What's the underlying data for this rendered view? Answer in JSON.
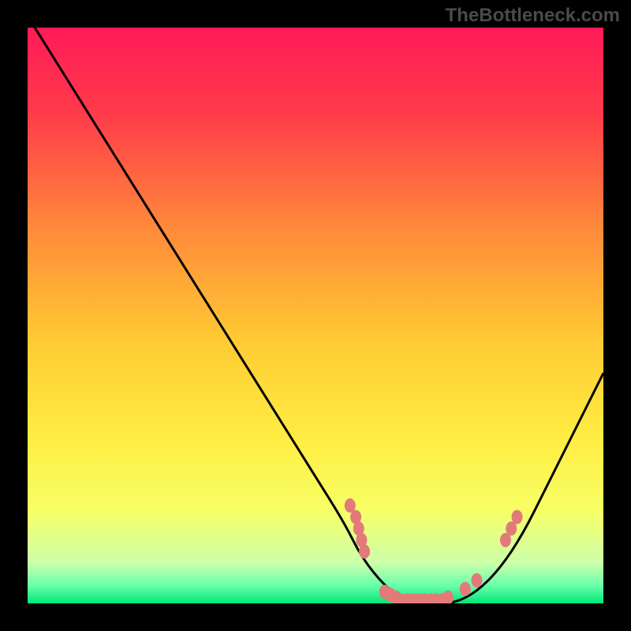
{
  "watermark": "TheBottleneck.com",
  "chart_data": {
    "type": "line",
    "title": "",
    "xlabel": "",
    "ylabel": "",
    "xlim": [
      0,
      100
    ],
    "ylim": [
      0,
      100
    ],
    "curve": {
      "description": "V-shaped bottleneck curve",
      "x": [
        0,
        5,
        10,
        15,
        20,
        25,
        30,
        35,
        40,
        45,
        50,
        55,
        58,
        62,
        66,
        70,
        74,
        78,
        82,
        86,
        90,
        95,
        100
      ],
      "y": [
        102,
        94,
        86,
        78,
        70,
        62,
        54,
        46,
        38,
        30,
        22,
        14,
        8,
        3,
        0,
        0,
        0,
        2,
        6,
        12,
        20,
        30,
        40
      ]
    },
    "highlight_points": {
      "description": "Salmon marker dots on curve near minimum plateau",
      "color": "#e27a7a",
      "points": [
        {
          "x": 56,
          "y": 17
        },
        {
          "x": 57,
          "y": 15
        },
        {
          "x": 57.5,
          "y": 13
        },
        {
          "x": 58,
          "y": 11
        },
        {
          "x": 58.5,
          "y": 9
        },
        {
          "x": 62,
          "y": 2
        },
        {
          "x": 63,
          "y": 1.5
        },
        {
          "x": 64,
          "y": 1
        },
        {
          "x": 65,
          "y": 0.5
        },
        {
          "x": 66,
          "y": 0.5
        },
        {
          "x": 67,
          "y": 0.5
        },
        {
          "x": 68,
          "y": 0.5
        },
        {
          "x": 69,
          "y": 0.5
        },
        {
          "x": 70,
          "y": 0.5
        },
        {
          "x": 71,
          "y": 0.5
        },
        {
          "x": 72,
          "y": 0.5
        },
        {
          "x": 73,
          "y": 1
        },
        {
          "x": 76,
          "y": 2.5
        },
        {
          "x": 78,
          "y": 4
        },
        {
          "x": 83,
          "y": 11
        },
        {
          "x": 84,
          "y": 13
        },
        {
          "x": 85,
          "y": 15
        }
      ]
    },
    "background_gradient": {
      "description": "Vertical gradient from red/pink at top through orange, yellow, to green at bottom",
      "stops": [
        {
          "offset": 0,
          "color": "#ff1a58"
        },
        {
          "offset": 0.15,
          "color": "#ff3b4a"
        },
        {
          "offset": 0.35,
          "color": "#ff8a3a"
        },
        {
          "offset": 0.55,
          "color": "#ffcc33"
        },
        {
          "offset": 0.72,
          "color": "#ffee44"
        },
        {
          "offset": 0.84,
          "color": "#f7ff66"
        },
        {
          "offset": 0.93,
          "color": "#ccffaa"
        },
        {
          "offset": 0.97,
          "color": "#66ffaa"
        },
        {
          "offset": 1,
          "color": "#00e676"
        }
      ]
    }
  }
}
